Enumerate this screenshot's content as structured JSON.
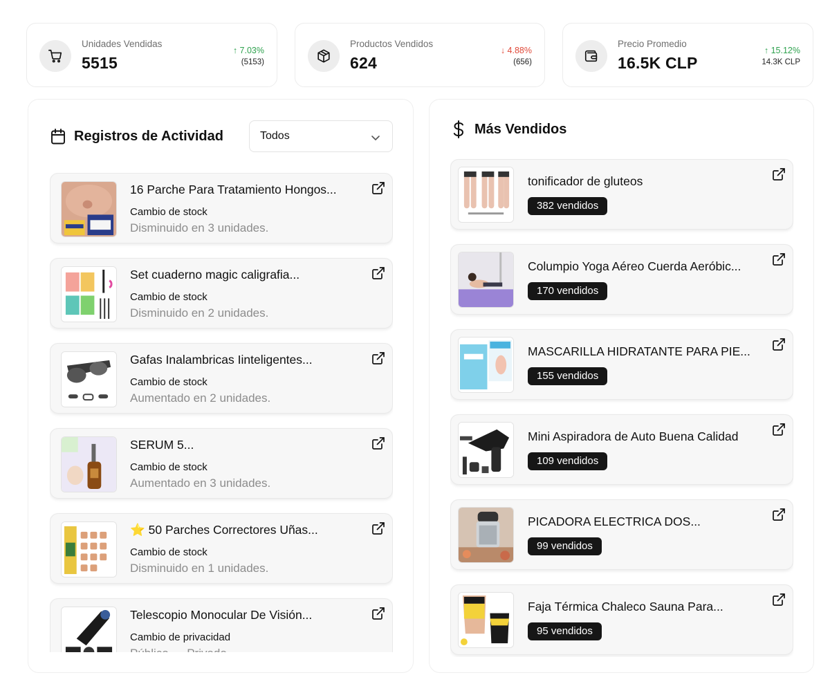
{
  "stats": [
    {
      "label": "Unidades Vendidas",
      "value": "5515",
      "change": "7.03%",
      "direction": "up",
      "previous": "(5153)",
      "icon": "shopping-cart-icon"
    },
    {
      "label": "Productos Vendidos",
      "value": "624",
      "change": "4.88%",
      "direction": "down",
      "previous": "(656)",
      "icon": "package-box-icon"
    },
    {
      "label": "Precio Promedio",
      "value": "16.5K CLP",
      "change": "15.12%",
      "direction": "up",
      "previous": "14.3K CLP",
      "icon": "wallet-icon"
    }
  ],
  "activity": {
    "title": "Registros de Actividad",
    "icon": "calendar-icon",
    "filter": {
      "selected": "Todos"
    },
    "items": [
      {
        "title": "16 Parche Para Tratamiento Hongos...",
        "type": "Cambio de stock",
        "detail": "Disminuido en 3 unidades.",
        "image": "foot-patch-package"
      },
      {
        "title": "Set cuaderno magic caligrafia...",
        "type": "Cambio de stock",
        "detail": "Disminuido en 2 unidades.",
        "image": "calligraphy-notebooks"
      },
      {
        "title": "Gafas Inalambricas Iinteligentes...",
        "type": "Cambio de stock",
        "detail": "Aumentado en 2 unidades.",
        "image": "smart-glasses"
      },
      {
        "title": "SERUM 5...",
        "type": "Cambio de stock",
        "detail": "Aumentado en 3 unidades.",
        "image": "serum-bottle"
      },
      {
        "title": "⭐ 50 Parches Correctores Uñas...",
        "type": "Cambio de stock",
        "detail": "Disminuido en 1 unidades.",
        "image": "nail-patches"
      },
      {
        "title": "Telescopio Monocular De Visión...",
        "type": "Cambio de privacidad",
        "detail": "Público → Privado",
        "image": "monocular-telescope"
      }
    ]
  },
  "bestsellers": {
    "title": "Más Vendidos",
    "icon": "dollar-sign-icon",
    "items": [
      {
        "title": "tonificador de gluteos",
        "sold": "382 vendidos",
        "image": "glute-toner"
      },
      {
        "title": "Columpio Yoga Aéreo Cuerda Aeróbic...",
        "sold": "170 vendidos",
        "image": "aerial-yoga"
      },
      {
        "title": "MASCARILLA HIDRATANTE PARA PIE...",
        "sold": "155 vendidos",
        "image": "foot-mask"
      },
      {
        "title": "Mini Aspiradora de Auto Buena Calidad",
        "sold": "109 vendidos",
        "image": "car-vacuum"
      },
      {
        "title": "PICADORA ELECTRICA DOS...",
        "sold": "99 vendidos",
        "image": "electric-chopper"
      },
      {
        "title": "Faja Térmica Chaleco Sauna Para...",
        "sold": "95 vendidos",
        "image": "sauna-vest"
      }
    ]
  },
  "colors": {
    "up": "#2fa24f",
    "down": "#e04a3a",
    "badge": "#161616"
  }
}
